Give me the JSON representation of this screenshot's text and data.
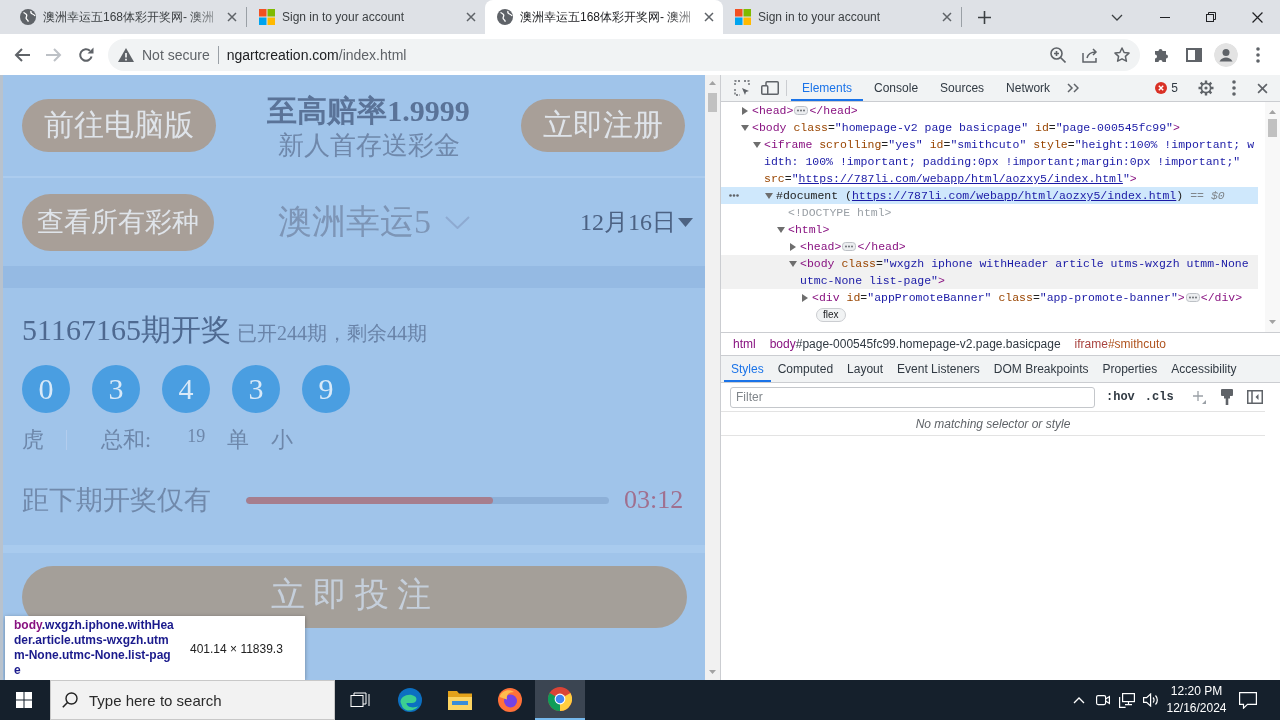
{
  "browser": {
    "tabs": [
      {
        "title": "澳洲幸运五168体彩开奖网- 澳洲",
        "kind": "globe",
        "selected": false
      },
      {
        "title": "Sign in to your account",
        "kind": "squares",
        "selected": false
      },
      {
        "title": "澳洲幸运五168体彩开奖网- 澳洲",
        "kind": "globe",
        "selected": true
      },
      {
        "title": "Sign in to your account",
        "kind": "squares",
        "selected": false
      }
    ],
    "nav": [
      {
        "kind": "back",
        "disabled": false
      },
      {
        "kind": "forward",
        "disabled": true
      },
      {
        "kind": "reload",
        "disabled": false
      }
    ],
    "address": {
      "security": "Not secure",
      "host": "ngartcreation.com",
      "path": "/index.html"
    }
  },
  "page": {
    "desktop_button": "前往电脑版",
    "promo_title": "至高赔率1.9999",
    "promo_subtitle": "新人首存送彩金",
    "register_button": "立即注册",
    "all_games_button": "查看所有彩种",
    "game_select": "澳洲幸运5",
    "date_select": "12月16日",
    "issue": "51167165期开奖",
    "issue_summary": "已开244期，剩余44期",
    "balls": [
      "0",
      "3",
      "4",
      "3",
      "9"
    ],
    "zodiac": "虎",
    "sum_label": "总和:",
    "sum": "19",
    "tags": [
      "单",
      "小"
    ],
    "countdown": {
      "label": "距下期开奖仅有",
      "level": 0.68,
      "time": "03:12"
    },
    "bet_button": "立即投注"
  },
  "inspect_tooltip": {
    "tag": "body",
    "classes": ".wxgzh.iphone.withHeader.article.utms-wxgzh.utmm-None.utmc-None.list-page",
    "size": "401.14 × 11839.3"
  },
  "devtools": {
    "tabs": [
      {
        "label": "Elements",
        "selected": true
      },
      {
        "label": "Console",
        "selected": false
      },
      {
        "label": "Sources",
        "selected": false
      },
      {
        "label": "Network",
        "selected": false
      }
    ],
    "error_count": "5",
    "dom_tree": [
      {
        "kind": "element",
        "open": "<head>",
        "close": "</head>",
        "expanded": false,
        "selected": false,
        "hovered": false
      },
      {
        "kind": "element",
        "open": "<body class=\"homepage-v2 page basicpage\" id=\"page-000545fc99\">",
        "expanded": true,
        "selected": false,
        "hovered": false,
        "children": [
          {
            "kind": "element",
            "open": "<iframe scrolling=\"yes\" id=\"smithcuto\" style=\"height:100% !important; width: 100% !important; padding:0px !important;margin:0px !important;\" src=\"",
            "link": "https://787li.com/webapp/html/aozxy5/index.html",
            "after_link": "\">",
            "expanded": true,
            "selected": false,
            "hovered": false,
            "children": [
              {
                "kind": "document",
                "open": "#document (",
                "link": "https://787li.com/webapp/html/aozxy5/index.html",
                "after_link": ")",
                "console_ref": "== *$0*",
                "expanded": true,
                "selected": true,
                "hovered": false,
                "children": [
                  {
                    "kind": "doctype",
                    "text": "<!DOCTYPE html>",
                    "selected": false,
                    "hovered": false
                  },
                  {
                    "kind": "element",
                    "open": "<html>",
                    "expanded": true,
                    "selected": false,
                    "hovered": false,
                    "children": [
                      {
                        "kind": "element",
                        "open": "<head>",
                        "close": "</head>",
                        "expanded": false,
                        "selected": false,
                        "hovered": false
                      },
                      {
                        "kind": "element",
                        "open": "<body class=\"wxgzh iphone withHeader article utms-wxgzh utmm-None utmc-None list-page\">",
                        "expanded": true,
                        "selected": false,
                        "hovered": true,
                        "children": [
                          {
                            "kind": "element",
                            "open": "<div id=\"appPromoteBanner\" class=\"app-promote-banner\">",
                            "close": "</div>",
                            "expanded": false,
                            "selected": false,
                            "hovered": false,
                            "badge": "flex"
                          }
                        ]
                      }
                    ]
                  }
                ]
              }
            ]
          }
        ]
      }
    ],
    "breadcrumbs": [
      {
        "tag": "html",
        "selected": false
      },
      {
        "tag": "body",
        "detail": "#page-000545fc99.homepage-v2.page.basicpage",
        "selected": false
      },
      {
        "tag": "iframe",
        "detail": "#smithcuto",
        "selected": true
      }
    ],
    "sidebar_tabs": [
      {
        "label": "Styles",
        "selected": true
      },
      {
        "label": "Computed",
        "selected": false
      },
      {
        "label": "Layout",
        "selected": false
      },
      {
        "label": "Event Listeners",
        "selected": false
      },
      {
        "label": "DOM Breakpoints",
        "selected": false
      },
      {
        "label": "Properties",
        "selected": false
      },
      {
        "label": "Accessibility",
        "selected": false
      }
    ],
    "filter": {
      "placeholder": "Filter"
    },
    "style_buttons": [
      ":hov",
      ".cls"
    ],
    "empty_message": "No matching selector or style"
  },
  "taskbar": {
    "search_placeholder": "Type here to search",
    "apps": [
      {
        "kind": "task-view",
        "active": false
      },
      {
        "kind": "edge",
        "active": false
      },
      {
        "kind": "explorer",
        "active": false
      },
      {
        "kind": "firefox",
        "active": false
      },
      {
        "kind": "chrome",
        "active": true
      }
    ],
    "time": "12:20 PM",
    "date": "12/16/2024"
  }
}
